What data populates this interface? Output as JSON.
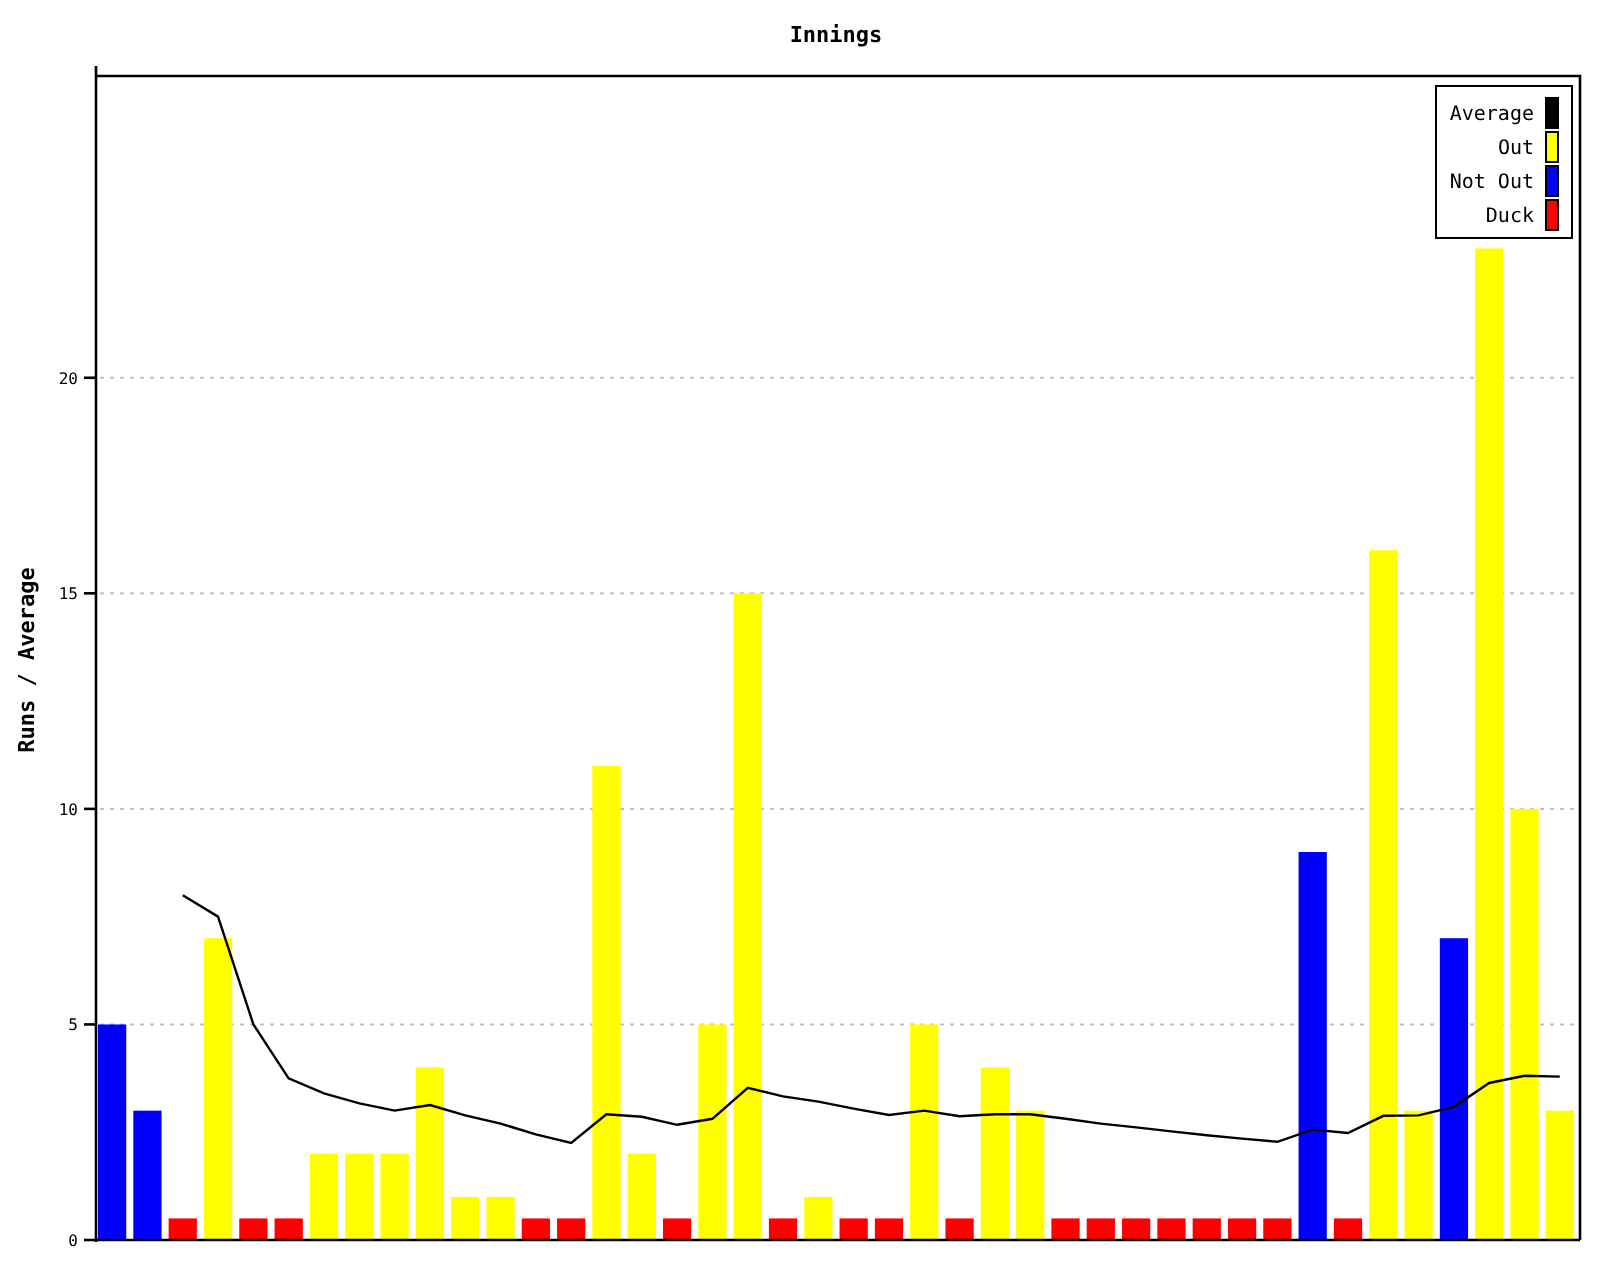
{
  "chart": {
    "chart_data": {
      "type": "bar",
      "title": "Innings",
      "ylabel": "Runs / Average",
      "ylim": [
        0,
        27
      ],
      "yticks": [
        0,
        5,
        10,
        15,
        20
      ],
      "stacked": true,
      "grid": true,
      "legend": true,
      "series": [
        {
          "name": "Average",
          "color": "#000000",
          "type": "line",
          "values": [
            null,
            null,
            8,
            7.5,
            5,
            3.75,
            3.4,
            3.17,
            3,
            3.13,
            2.89,
            2.7,
            2.45,
            2.25,
            2.92,
            2.86,
            2.67,
            2.81,
            3.53,
            3.33,
            3.21,
            3.05,
            2.9,
            3,
            2.87,
            2.92,
            2.92,
            2.81,
            2.7,
            2.61,
            2.52,
            2.43,
            2.35,
            2.28,
            2.56,
            2.48,
            2.88,
            2.89,
            3.09,
            3.64,
            3.81,
            3.79
          ]
        },
        {
          "name": "Out",
          "color": "#ffff00",
          "values": [
            null,
            null,
            null,
            7,
            null,
            null,
            2,
            2,
            2,
            4,
            1,
            1,
            null,
            null,
            11,
            2,
            null,
            5,
            15,
            null,
            1,
            null,
            null,
            5,
            null,
            4,
            3,
            null,
            null,
            null,
            null,
            null,
            null,
            null,
            null,
            null,
            16,
            3,
            null,
            23,
            10,
            3
          ]
        },
        {
          "name": "Not Out",
          "color": "#0000ff",
          "values": [
            5,
            3,
            null,
            null,
            null,
            null,
            null,
            null,
            null,
            null,
            null,
            null,
            null,
            null,
            null,
            null,
            null,
            null,
            null,
            null,
            null,
            null,
            null,
            null,
            null,
            null,
            null,
            null,
            null,
            null,
            null,
            null,
            null,
            null,
            9,
            null,
            null,
            null,
            7,
            null,
            null,
            null
          ]
        },
        {
          "name": "Duck",
          "color": "#ff0000",
          "values": [
            null,
            null,
            0.5,
            null,
            0.5,
            0.5,
            null,
            null,
            null,
            null,
            null,
            null,
            0.5,
            0.5,
            null,
            null,
            0.5,
            null,
            null,
            0.5,
            null,
            0.5,
            0.5,
            null,
            0.5,
            null,
            null,
            0.5,
            0.5,
            0.5,
            0.5,
            0.5,
            0.5,
            0.5,
            null,
            0.5,
            null,
            null,
            null,
            null,
            null,
            null
          ]
        }
      ]
    }
  }
}
